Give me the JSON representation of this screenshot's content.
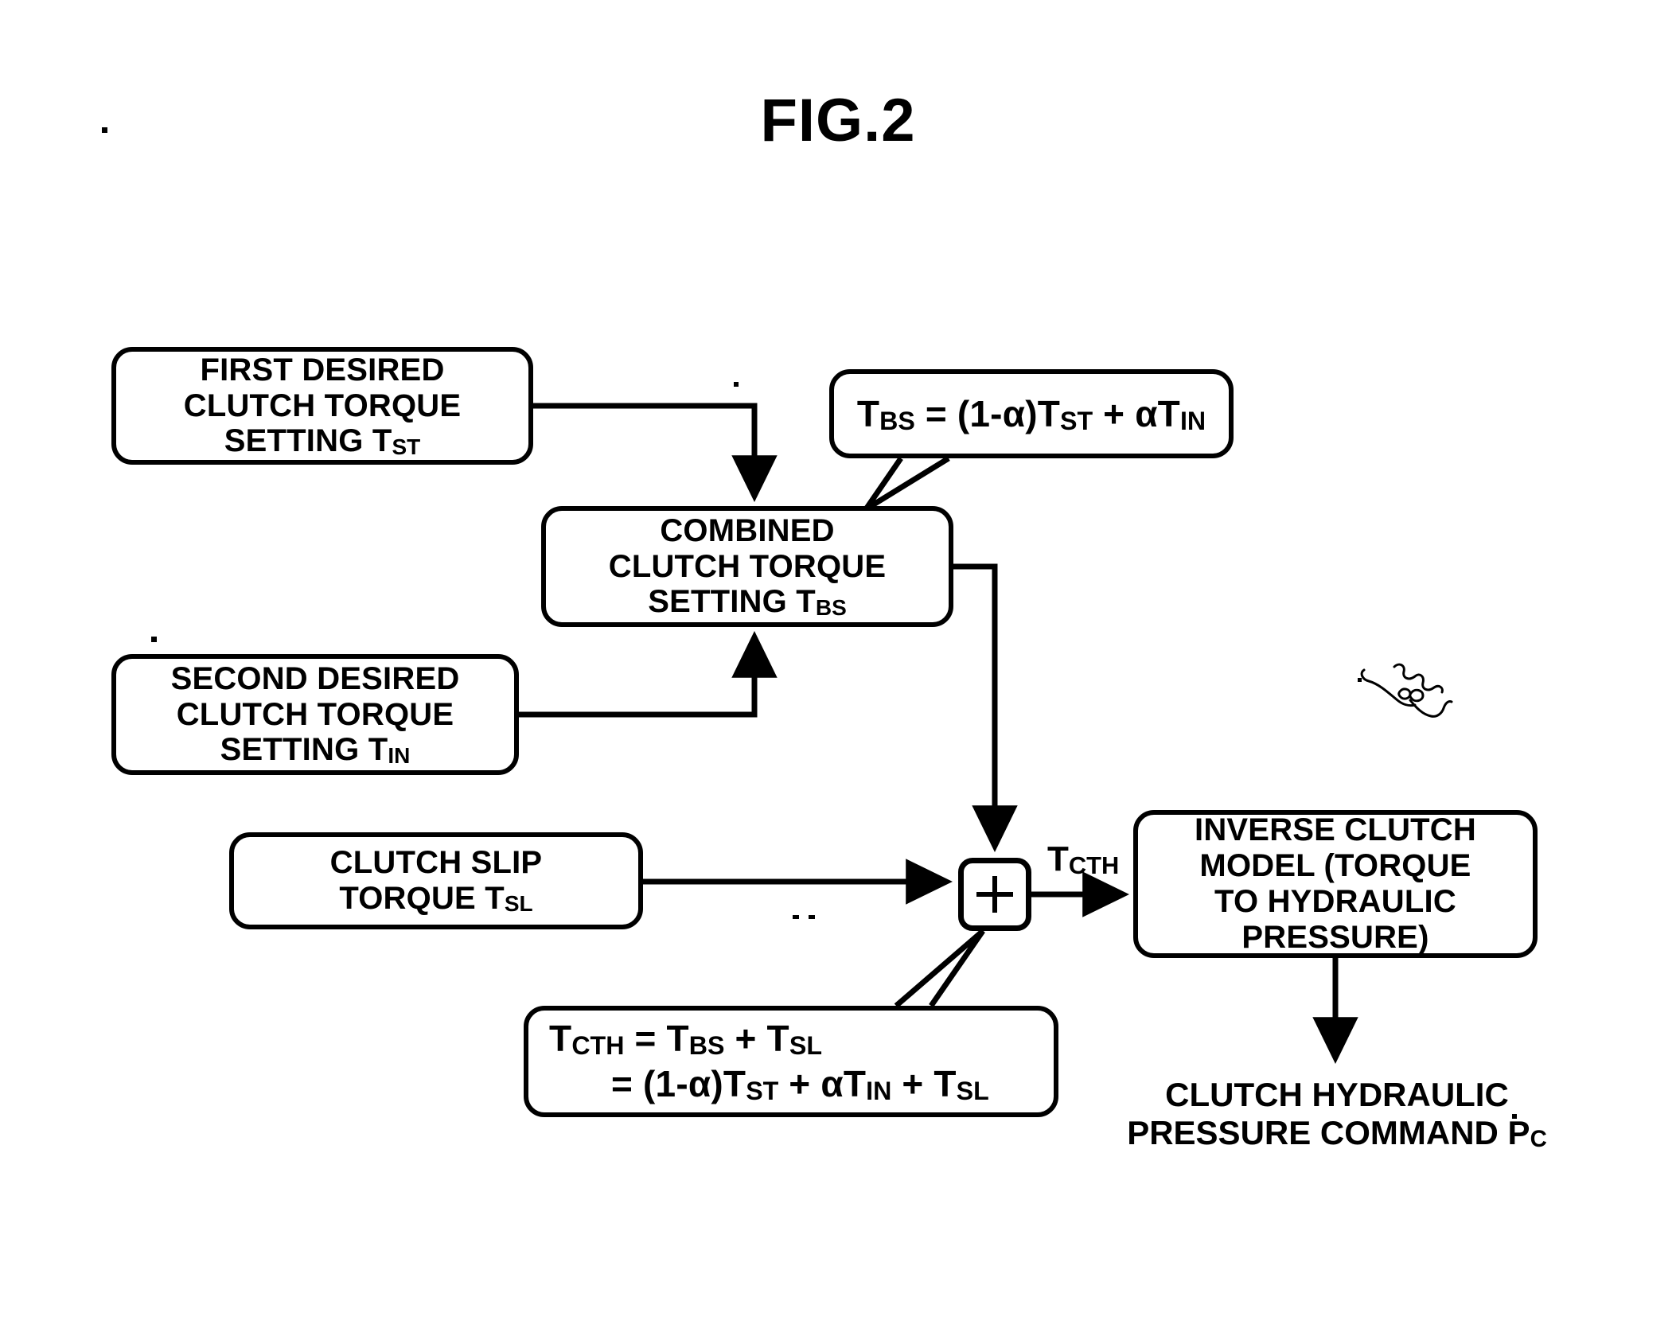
{
  "figure": {
    "title": "FIG.2"
  },
  "nodes": {
    "first_desired": {
      "line1": "FIRST DESIRED",
      "line2": "CLUTCH TORQUE",
      "line3_pre": "SETTING T",
      "line3_sub": "ST"
    },
    "second_desired": {
      "line1": "SECOND DESIRED",
      "line2": "CLUTCH TORQUE",
      "line3_pre": "SETTING T",
      "line3_sub": "IN"
    },
    "combined": {
      "line1": "COMBINED",
      "line2": "CLUTCH TORQUE",
      "line3_pre": "SETTING T",
      "line3_sub": "BS"
    },
    "clutch_slip": {
      "line1": "CLUTCH SLIP",
      "line2_pre": "TORQUE T",
      "line2_sub": "SL"
    },
    "inverse_model": {
      "line1": "INVERSE CLUTCH",
      "line2": "MODEL (TORQUE",
      "line3": "TO HYDRAULIC",
      "line4": "PRESSURE)"
    }
  },
  "callouts": {
    "tbs_formula": {
      "t": "T",
      "t_sub": "BS",
      "eq": " = (1-",
      "alpha": "α",
      "mid": ")T",
      "mid_sub": "ST",
      "plus": " + ",
      "alpha2": "α",
      "tail": "T",
      "tail_sub": "IN"
    },
    "tcth_formula": {
      "line1_t": "T",
      "line1_t_sub": "CTH",
      "line1_eq": " = T",
      "line1_b_sub": "BS",
      "line1_plus": " + T",
      "line1_c_sub": "SL",
      "line2_eq": "= (1-",
      "line2_alpha": "α",
      "line2_a": ")T",
      "line2_a_sub": "ST",
      "line2_plus": " + ",
      "line2_alpha2": "α",
      "line2_b": "T",
      "line2_b_sub": "IN",
      "line2_plus2": " + T",
      "line2_c_sub": "SL"
    }
  },
  "signals": {
    "sum_symbol": "+",
    "tcth_label_pre": "T",
    "tcth_label_sub": "CTH"
  },
  "output": {
    "line1": "CLUTCH HYDRAULIC",
    "line2": "PRESSURE",
    "line3_pre": "COMMAND P",
    "line3_sub": "C"
  },
  "colors": {
    "ink": "#000000",
    "paper": "#ffffff"
  }
}
